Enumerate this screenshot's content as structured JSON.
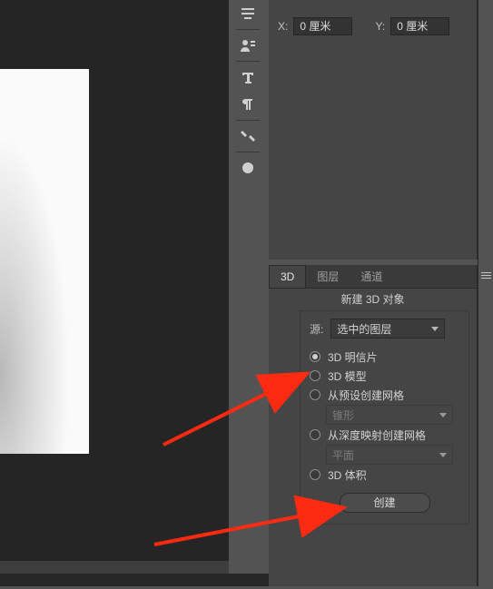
{
  "properties": {
    "x_label": "X:",
    "y_label": "Y:",
    "x_value": "0 厘米",
    "y_value": "0 厘米"
  },
  "tabs": {
    "t3d": "3D",
    "layers": "图层",
    "channels": "通道"
  },
  "section_title": "新建 3D 对象",
  "panel3d": {
    "source_label": "源:",
    "source_value": "选中的图层",
    "radios": {
      "postcard": "3D 明信片",
      "model": "3D 模型",
      "preset_mesh": "从预设创建网格",
      "depth_mesh": "从深度映射创建网格",
      "volume": "3D 体积"
    },
    "preset_value": "锥形",
    "depth_value": "平面",
    "create_button": "创建"
  },
  "tool_icons": [
    "align-icon",
    "user-icon",
    "type-icon",
    "paragraph-icon",
    "tools-icon",
    "cloud-icon"
  ]
}
